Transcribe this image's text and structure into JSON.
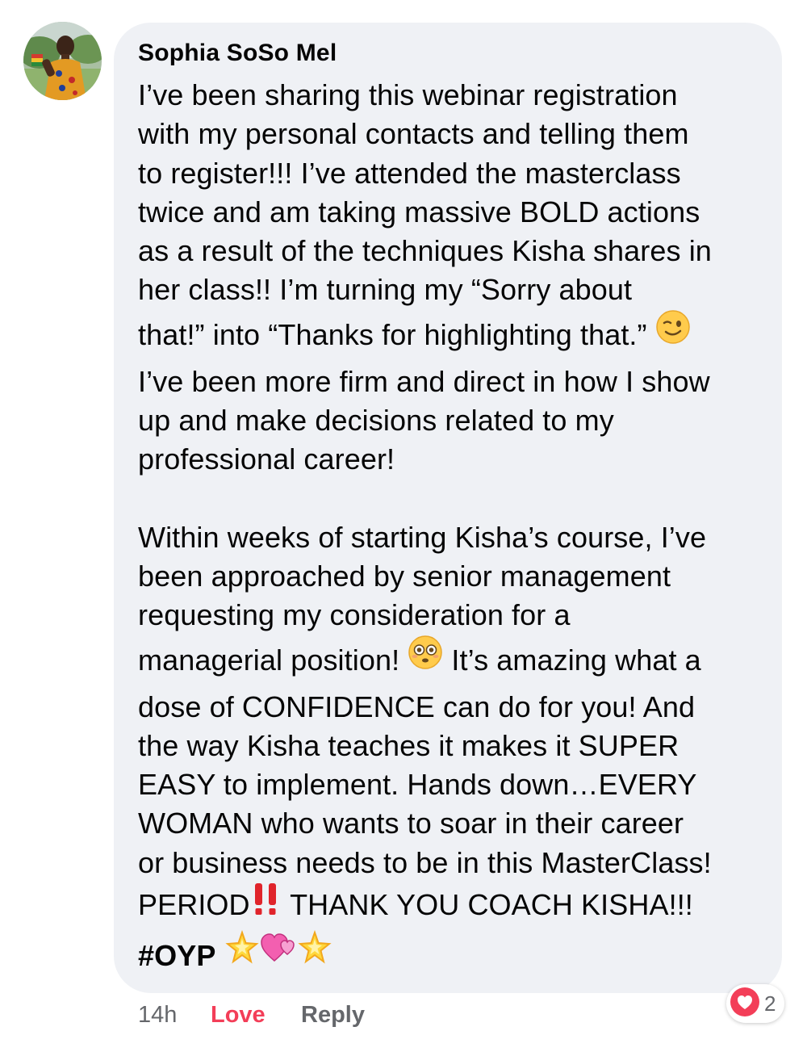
{
  "comment": {
    "author": "Sophia SoSo Mel",
    "lines": [
      "I’ve been sharing this webinar registration",
      "with my personal contacts and telling them",
      "to register!!! I’ve attended the masterclass",
      "twice and am taking massive BOLD actions",
      "as a result of the techniques Kisha shares in",
      "her class!! I’m turning my “Sorry about",
      "that!” into “Thanks for highlighting that.”",
      "I’ve been more firm and direct in how I show",
      "up and make decisions related to my",
      "professional career!",
      "Within weeks of starting Kisha’s course, I’ve",
      "been approached by senior management",
      "requesting my consideration for a",
      "managerial position!",
      " It’s amazing what a",
      "dose of CONFIDENCE can do for you! And",
      "the way Kisha teaches it makes it SUPER",
      "EASY to implement. Hands down…EVERY",
      "WOMAN who wants to soar in their career",
      "or business needs to be in this MasterClass!",
      "PERIOD",
      " THANK YOU COACH KISHA!!!",
      "#OYP"
    ],
    "emojis": {
      "wink": "winking-face",
      "flushed": "flushed-face",
      "double_exclamation": "double-exclamation-mark",
      "glowing_star": "glowing-star",
      "two_hearts": "two-hearts"
    }
  },
  "actions": {
    "time": "14h",
    "love": "Love",
    "reply": "Reply"
  },
  "reactions": {
    "type": "love",
    "count": "2",
    "color": "#f33e58"
  },
  "colors": {
    "bubble": "#eff1f5",
    "meta_text": "#65676b",
    "love_accent": "#f33e58"
  }
}
